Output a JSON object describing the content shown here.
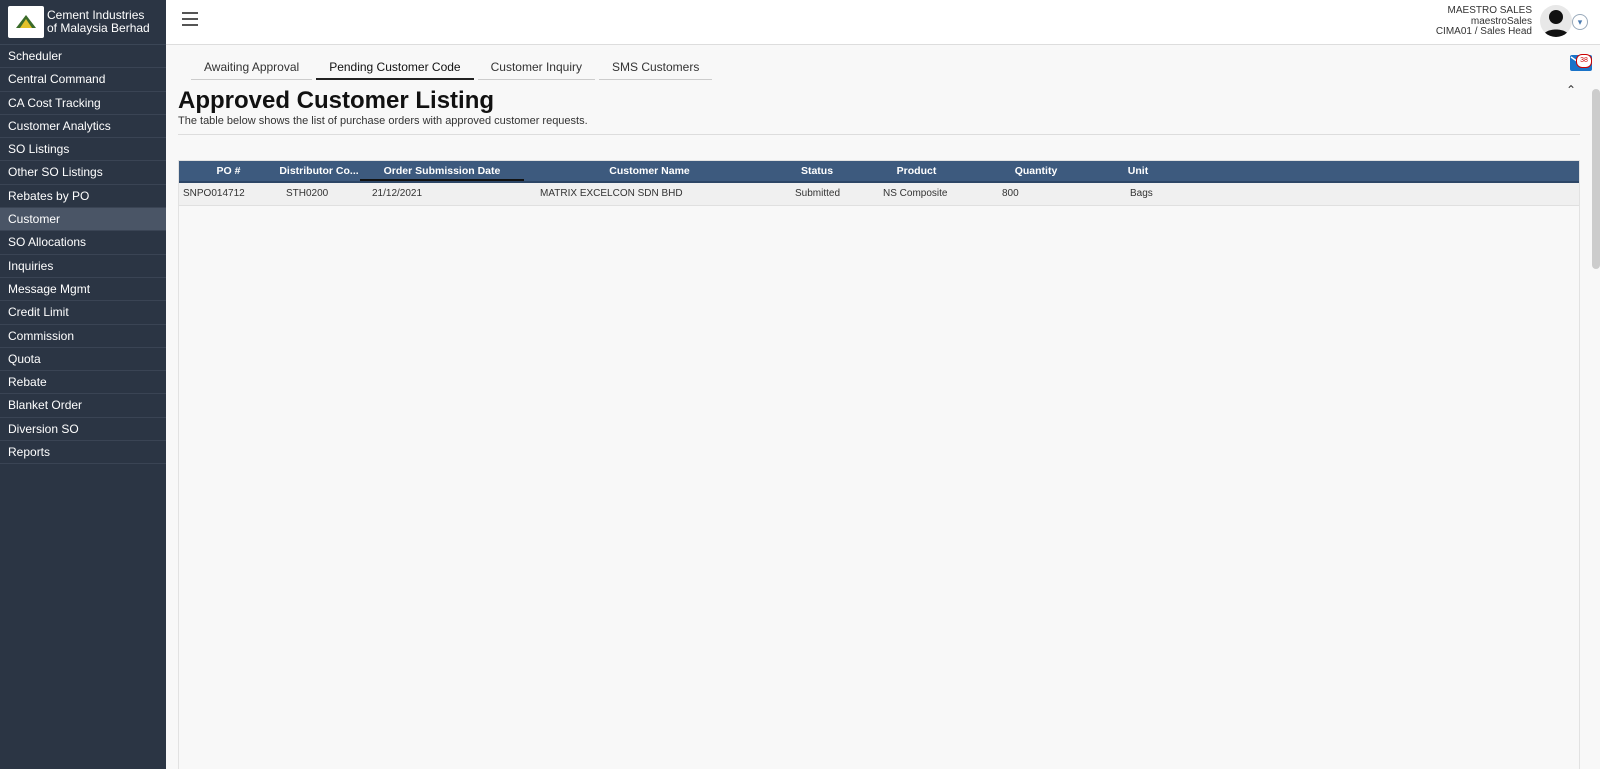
{
  "brand": {
    "name": "Cement Industries of Malaysia Berhad"
  },
  "sidebar": {
    "items": [
      {
        "label": "Scheduler"
      },
      {
        "label": "Central Command"
      },
      {
        "label": "CA Cost Tracking"
      },
      {
        "label": "Customer Analytics"
      },
      {
        "label": "SO Listings"
      },
      {
        "label": "Other SO Listings"
      },
      {
        "label": "Rebates by PO"
      },
      {
        "label": "Customer"
      },
      {
        "label": "SO Allocations"
      },
      {
        "label": "Inquiries"
      },
      {
        "label": "Message Mgmt"
      },
      {
        "label": "Credit Limit"
      },
      {
        "label": "Commission"
      },
      {
        "label": "Quota"
      },
      {
        "label": "Rebate"
      },
      {
        "label": "Blanket Order"
      },
      {
        "label": "Diversion SO"
      },
      {
        "label": "Reports"
      }
    ],
    "active": "Customer"
  },
  "header": {
    "user_name": "MAESTRO SALES",
    "user_login": "maestroSales",
    "user_role": "CIMA01 / Sales Head"
  },
  "tabs": [
    {
      "label": "Awaiting Approval"
    },
    {
      "label": "Pending Customer Code"
    },
    {
      "label": "Customer Inquiry"
    },
    {
      "label": "SMS Customers"
    }
  ],
  "notifications": {
    "count": "38"
  },
  "page": {
    "title": "Approved Customer Listing",
    "subtitle": "The table below shows the list of purchase orders with approved customer requests."
  },
  "table": {
    "columns": [
      "PO #",
      "Distributor Co...",
      "Order Submission Date",
      "Customer Name",
      "Status",
      "Product",
      "Quantity",
      "Unit"
    ],
    "rows": [
      [
        "SNPO014712",
        "STH0200",
        "21/12/2021",
        "MATRIX EXCELCON SDN BHD",
        "Submitted",
        "NS Composite",
        "800",
        "Bags"
      ]
    ]
  },
  "colors": {
    "sidebar": "#2b3544",
    "table_header": "#3d5a7e",
    "mail": "#1a73c8"
  }
}
